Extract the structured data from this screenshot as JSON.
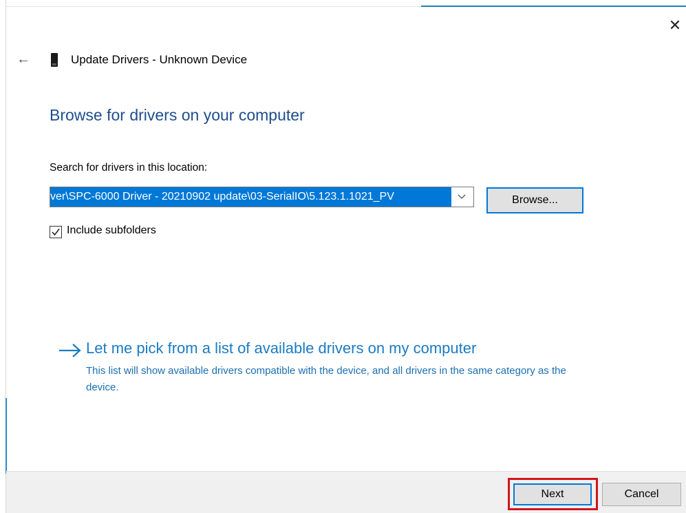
{
  "window": {
    "title": "Update Drivers - Unknown Device",
    "close_glyph": "✕",
    "back_glyph": "←",
    "accent_color": "#0078d7"
  },
  "main": {
    "heading": "Browse for drivers on your computer",
    "search_label": "Search for drivers in this location:",
    "path_value": "ver\\SPC-6000 Driver - 20210902 update\\03-SerialIO\\5.123.1.1021_PV",
    "browse_label": "Browse...",
    "include_subfolders_label": "Include subfolders",
    "include_subfolders_checked": true,
    "pick_link_label": "Let me pick from a list of available drivers on my computer",
    "pick_description": "This list will show available drivers compatible with the device, and all drivers in the same category as the device."
  },
  "footer": {
    "next_label": "Next",
    "cancel_label": "Cancel"
  },
  "icons": {
    "device": "device-icon",
    "dropdown": "chevron-down-icon",
    "arrow": "arrow-right-icon",
    "check": "checkmark-icon"
  }
}
